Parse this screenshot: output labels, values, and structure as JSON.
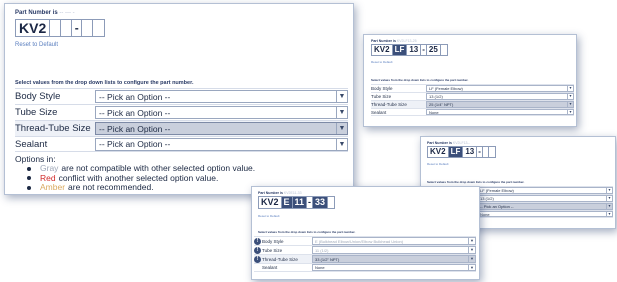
{
  "main": {
    "part_number_label": "Part Number is",
    "part_number_hint": "-- --- -",
    "part_number_prefix": "KV2",
    "part_number_separator": "-",
    "reset_link": "Reset to Default",
    "instructions": "Select values from the drop down lists to configure the part number.",
    "options": [
      {
        "label": "Body Style",
        "value": "-- Pick an Option --",
        "highlighted": false
      },
      {
        "label": "Tube Size",
        "value": "-- Pick an Option --",
        "highlighted": false
      },
      {
        "label": "Thread-Tube Size",
        "value": "-- Pick an Option --",
        "highlighted": true
      },
      {
        "label": "Sealant",
        "value": "-- Pick an Option --",
        "highlighted": false
      }
    ],
    "legend_heading": "Options in:",
    "legend": [
      {
        "word": "Gray",
        "rest": "are not compatible with other selected option value.",
        "color": "#9ea7b8"
      },
      {
        "word": "Red",
        "rest": "conflict with another selected option value.",
        "color": "#d12a2a"
      },
      {
        "word": "Amber",
        "rest": "are not recommended.",
        "color": "#d9aa60"
      }
    ]
  },
  "panel_a": {
    "part_number_label": "Part Number is",
    "part_number_hint": "KV2LF13-25",
    "segments": [
      "KV2",
      "LF",
      "13",
      "-",
      "25"
    ],
    "reset_link": "Reset to Default",
    "instructions": "Select values from the drop down lists to configure the part number.",
    "rows": [
      {
        "label": "Body Style",
        "value": "LF (Female Elbow)"
      },
      {
        "label": "Tube Size",
        "value": "13 (1/2)"
      },
      {
        "label": "Thread-Tube Size",
        "value": "25 (1/4\" NPT)"
      },
      {
        "label": "Sealant",
        "value": "None"
      }
    ]
  },
  "panel_b": {
    "part_number_label": "Part Number is",
    "part_number_hint": "KV2LF13--",
    "segments": [
      "KV2",
      "LF",
      "13",
      "-"
    ],
    "reset_link": "Reset to Default",
    "instructions": "Select values from the drop down lists to configure the part number.",
    "rows": [
      {
        "label": "Body Style",
        "value": "LF (Female Elbow)"
      },
      {
        "label": "Tube Size",
        "value": "13 (1/2)"
      },
      {
        "label": "Thread-Tube Size",
        "value": "-- Pick an Option --"
      },
      {
        "label": "Sealant",
        "value": "None"
      }
    ]
  },
  "panel_c": {
    "part_number_label": "Part Number is",
    "part_number_hint": "KV2E11-33",
    "segments": [
      "KV2",
      "E",
      "11",
      "-",
      "33"
    ],
    "reset_link": "Reset to Default",
    "instructions": "Select values from the drop down lists to configure the part number.",
    "rows": [
      {
        "indicator": "!",
        "label": "Body Style",
        "value": "E (Bulkhead Elbow/Union/Elbow Bulkhead Union)"
      },
      {
        "indicator": "!",
        "label": "Tube Size",
        "value": "11 (1/2)"
      },
      {
        "indicator": "!",
        "label": "Thread-Tube Size",
        "value": "33 (1/2\" NPT)"
      },
      {
        "indicator": "",
        "label": "Sealant",
        "value": "None"
      }
    ]
  },
  "colors": {
    "accent": "#3b4f7a",
    "link": "#5b7fbf",
    "gray_option": "#9ea7b8",
    "red_option": "#d12a2a",
    "amber_option": "#d9aa60"
  },
  "icons": {
    "dropdown": "chevron-down-icon",
    "bullet": "bullet-icon",
    "warning": "warning-icon"
  }
}
